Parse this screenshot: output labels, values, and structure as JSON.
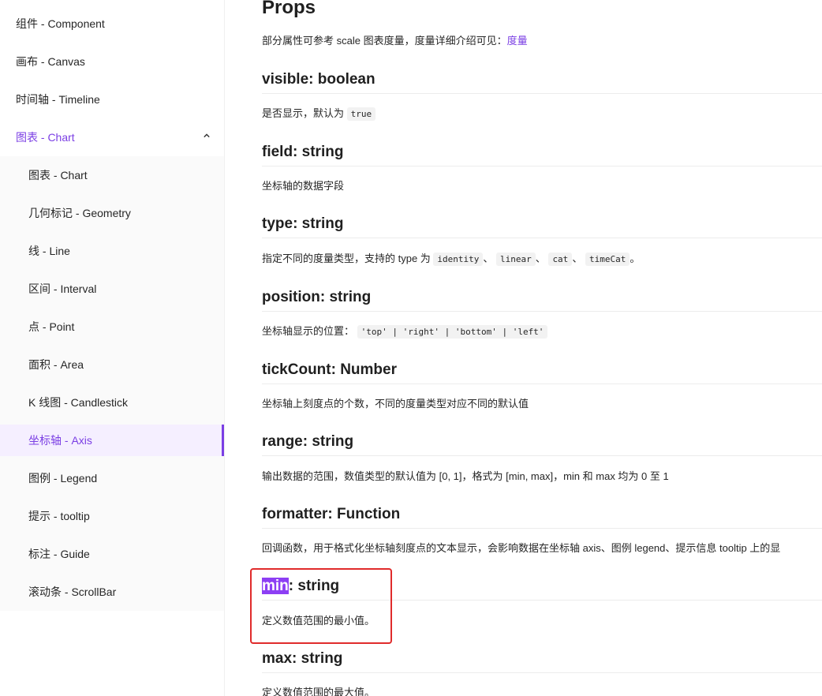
{
  "sidebar": {
    "top_items": [
      {
        "label": "组件 - Component"
      },
      {
        "label": "画布 - Canvas"
      },
      {
        "label": "时间轴 - Timeline"
      },
      {
        "label": "图表 - Chart"
      }
    ],
    "sub_items": [
      {
        "label": "图表 - Chart"
      },
      {
        "label": "几何标记 - Geometry"
      },
      {
        "label": "线 - Line"
      },
      {
        "label": "区间 - Interval"
      },
      {
        "label": "点 - Point"
      },
      {
        "label": "面积 - Area"
      },
      {
        "label": "K 线图 - Candlestick"
      },
      {
        "label": "坐标轴 - Axis"
      },
      {
        "label": "图例 - Legend"
      },
      {
        "label": "提示 - tooltip"
      },
      {
        "label": "标注 - Guide"
      },
      {
        "label": "滚动条 - ScrollBar"
      }
    ],
    "accent_color": "#7b3fe4"
  },
  "content": {
    "title": "Props",
    "intro_text": "部分属性可参考 scale 图表度量，度量详细介绍可见：",
    "intro_link": "度量",
    "props": [
      {
        "name": "visible: boolean",
        "desc": "是否显示，默认为",
        "code": "true"
      },
      {
        "name": "field: string",
        "desc": "坐标轴的数据字段"
      },
      {
        "name": "type: string",
        "desc": "指定不同的度量类型，支持的 type 为",
        "codes": [
          "identity",
          "linear",
          "cat",
          "timeCat"
        ],
        "sep": "、",
        "end": "。"
      },
      {
        "name": "position: string",
        "desc": "坐标轴显示的位置：",
        "code": "'top' | 'right' | 'bottom' | 'left'"
      },
      {
        "name": "tickCount: Number",
        "desc": "坐标轴上刻度点的个数，不同的度量类型对应不同的默认值"
      },
      {
        "name": "range: string",
        "desc": "输出数据的范围，数值类型的默认值为 [0, 1]，格式为 [min, max]，min 和 max 均为 0 至 1"
      },
      {
        "name": "formatter: Function",
        "desc": "回调函数，用于格式化坐标轴刻度点的文本显示，会影响数据在坐标轴 axis、图例 legend、提示信息 tooltip 上的显"
      },
      {
        "name_highlight": "min",
        "name_rest": ": string",
        "desc": "定义数值范围的最小值。"
      },
      {
        "name": "max: string",
        "desc": "定义数值范围的最大值。"
      }
    ]
  }
}
